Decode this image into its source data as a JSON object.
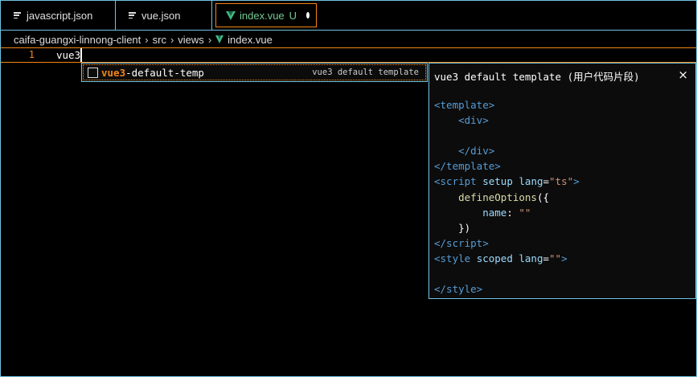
{
  "tabs": [
    {
      "label": "javascript.json",
      "icon": "json-file-icon"
    },
    {
      "label": "vue.json",
      "icon": "json-file-icon"
    },
    {
      "label": "index.vue",
      "badge": "U",
      "icon": "vue-file-icon",
      "active": true,
      "dirty": true
    }
  ],
  "breadcrumb": [
    "caifa-guangxi-linnong-client",
    "src",
    "views",
    "index.vue"
  ],
  "editor": {
    "line_number": "1",
    "line_text": "vue3"
  },
  "suggestion": {
    "match": "vue3",
    "rest": "-default-temp",
    "detail": "vue3 default template",
    "icon": "snippet-icon"
  },
  "details": {
    "title": "vue3 default template (用户代码片段)",
    "close": "×"
  },
  "colors": {
    "border": "#6fc3df",
    "focus": "#f38518",
    "vue_green": "#41b883",
    "untracked": "#73c991"
  }
}
